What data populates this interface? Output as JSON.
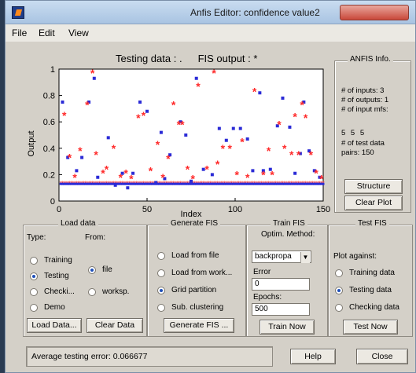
{
  "window": {
    "title": "Anfis Editor: confidence value2"
  },
  "menu": {
    "file": "File",
    "edit": "Edit",
    "view": "View"
  },
  "plot_header": {
    "left": "Testing data : .",
    "right": "FIS output : *"
  },
  "chart_data": {
    "type": "scatter",
    "xlabel": "Index",
    "ylabel": "Output",
    "xlim": [
      0,
      150
    ],
    "ylim": [
      0,
      1
    ],
    "x_ticks": [
      "0",
      "50",
      "100",
      "150"
    ],
    "y_ticks": [
      "0",
      "0.2",
      "0.4",
      "0.6",
      "0.8",
      "1"
    ],
    "grid": false,
    "series": [
      {
        "marker": "dot",
        "color": "#2b2bd6",
        "points": [
          [
            2,
            0.75
          ],
          [
            5,
            0.33
          ],
          [
            10,
            0.23
          ],
          [
            13,
            0.33
          ],
          [
            17,
            0.75
          ],
          [
            20,
            0.93
          ],
          [
            22,
            0.18
          ],
          [
            28,
            0.48
          ],
          [
            32,
            0.12
          ],
          [
            36,
            0.21
          ],
          [
            39,
            0.1
          ],
          [
            42,
            0.21
          ],
          [
            46,
            0.75
          ],
          [
            50,
            0.68
          ],
          [
            55,
            0.14
          ],
          [
            58,
            0.52
          ],
          [
            60,
            0.17
          ],
          [
            63,
            0.35
          ],
          [
            69,
            0.6
          ],
          [
            72,
            0.5
          ],
          [
            75,
            0.15
          ],
          [
            78,
            0.93
          ],
          [
            82,
            0.24
          ],
          [
            87,
            0.2
          ],
          [
            91,
            0.55
          ],
          [
            95,
            0.46
          ],
          [
            99,
            0.55
          ],
          [
            103,
            0.55
          ],
          [
            107,
            0.47
          ],
          [
            110,
            0.23
          ],
          [
            114,
            0.82
          ],
          [
            116,
            0.23
          ],
          [
            120,
            0.24
          ],
          [
            124,
            0.57
          ],
          [
            127,
            0.78
          ],
          [
            131,
            0.56
          ],
          [
            134,
            0.21
          ],
          [
            137,
            0.36
          ],
          [
            139,
            0.75
          ],
          [
            142,
            0.38
          ],
          [
            145,
            0.23
          ],
          [
            148,
            0.18
          ]
        ]
      },
      {
        "marker": "star",
        "color": "#ff2a2a",
        "points": [
          [
            3,
            0.65
          ],
          [
            6,
            0.33
          ],
          [
            9,
            0.18
          ],
          [
            12,
            0.38
          ],
          [
            16,
            0.73
          ],
          [
            19,
            0.97
          ],
          [
            21,
            0.35
          ],
          [
            25,
            0.21
          ],
          [
            27,
            0.24
          ],
          [
            31,
            0.4
          ],
          [
            35,
            0.18
          ],
          [
            38,
            0.21
          ],
          [
            41,
            0.17
          ],
          [
            45,
            0.63
          ],
          [
            48,
            0.65
          ],
          [
            52,
            0.23
          ],
          [
            56,
            0.43
          ],
          [
            59,
            0.18
          ],
          [
            62,
            0.32
          ],
          [
            65,
            0.73
          ],
          [
            68,
            0.58
          ],
          [
            70,
            0.58
          ],
          [
            73,
            0.24
          ],
          [
            76,
            0.17
          ],
          [
            79,
            0.87
          ],
          [
            84,
            0.24
          ],
          [
            88,
            0.97
          ],
          [
            90,
            0.28
          ],
          [
            93,
            0.4
          ],
          [
            97,
            0.4
          ],
          [
            101,
            0.2
          ],
          [
            104,
            0.45
          ],
          [
            107,
            0.18
          ],
          [
            111,
            0.83
          ],
          [
            116,
            0.2
          ],
          [
            119,
            0.38
          ],
          [
            121,
            0.2
          ],
          [
            125,
            0.58
          ],
          [
            128,
            0.4
          ],
          [
            132,
            0.35
          ],
          [
            134,
            0.64
          ],
          [
            136,
            0.35
          ],
          [
            138,
            0.73
          ],
          [
            140,
            0.63
          ],
          [
            143,
            0.35
          ],
          [
            146,
            0.21
          ],
          [
            149,
            0.17
          ]
        ]
      }
    ]
  },
  "info": {
    "title": "ANFIS Info.",
    "lines": [
      "# of inputs: 3",
      "# of outputs: 1",
      "# of input mfs:"
    ],
    "mfs": "5 5 5",
    "lines2": [
      "# of test data",
      "pairs: 150"
    ],
    "structure_btn": "Structure",
    "clear_plot_btn": "Clear Plot"
  },
  "load_data": {
    "title": "Load data",
    "type_label": "Type:",
    "from_label": "From:",
    "types": [
      "Training",
      "Testing",
      "Checki...",
      "Demo"
    ],
    "sources": [
      "file",
      "worksp."
    ],
    "load_btn": "Load Data...",
    "clear_btn": "Clear Data"
  },
  "generate": {
    "title": "Generate FIS",
    "options": [
      "Load from file",
      "Load from work...",
      "Grid partition",
      "Sub. clustering"
    ],
    "btn": "Generate FIS ..."
  },
  "train": {
    "title": "Train FIS",
    "method_label": "Optim. Method:",
    "method_value": "backpropa",
    "error_label": "Error",
    "error_value": "0",
    "epochs_label": "Epochs:",
    "epochs_value": "500",
    "btn": "Train Now"
  },
  "test": {
    "title": "Test FIS",
    "against": "Plot against:",
    "options": [
      "Training data",
      "Testing data",
      "Checking data"
    ],
    "btn": "Test Now"
  },
  "status": {
    "text": "Average testing error: 0.066677"
  },
  "footer": {
    "help": "Help",
    "close": "Close"
  }
}
